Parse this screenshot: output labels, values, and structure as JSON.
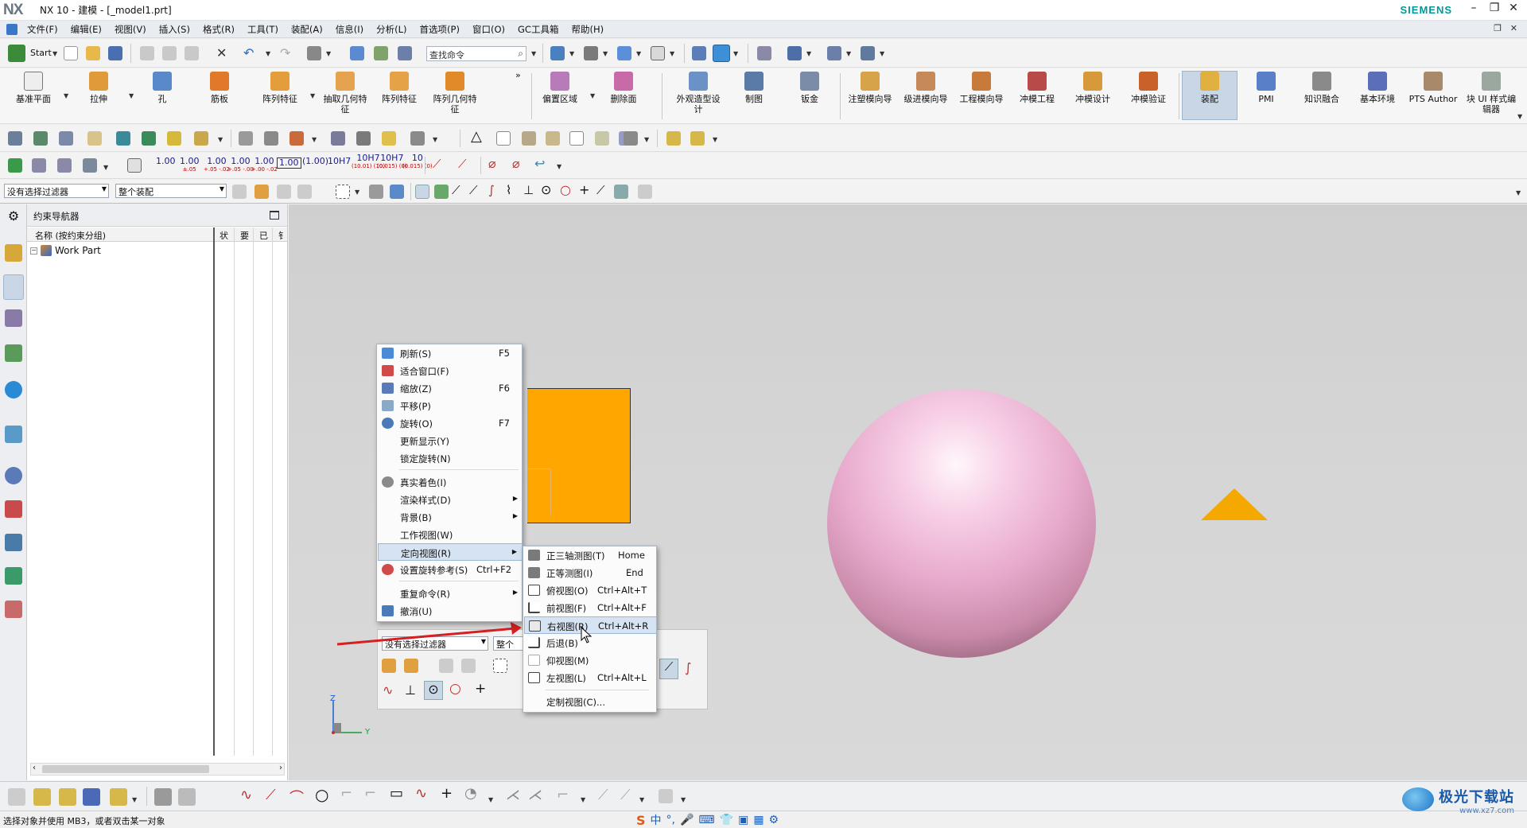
{
  "window": {
    "logo": "NX",
    "title": "NX 10 - 建模 - [_model1.prt]",
    "brand": "SIEMENS",
    "min": "–",
    "restore": "❐",
    "close": "✕"
  },
  "menubar": {
    "items": [
      "文件(F)",
      "编辑(E)",
      "视图(V)",
      "插入(S)",
      "格式(R)",
      "工具(T)",
      "装配(A)",
      "信息(I)",
      "分析(L)",
      "首选项(P)",
      "窗口(O)",
      "GC工具箱",
      "帮助(H)"
    ],
    "mdi_restore": "❐",
    "mdi_close": "✕"
  },
  "toolbar1": {
    "start": "Start",
    "search_placeholder": "查找命令"
  },
  "ribbon": {
    "items": [
      "基准平面",
      "拉伸",
      "孔",
      "筋板",
      "阵列特征",
      "抽取几何特征",
      "阵列特征",
      "阵列几何特征",
      "偏置区域",
      "删除面",
      "外观造型设计",
      "制图",
      "钣金",
      "注塑模向导",
      "级进模向导",
      "工程模向导",
      "冲模工程",
      "冲模设计",
      "冲模验证",
      "装配",
      "PMI",
      "知识融合",
      "基本环境",
      "PTS Author",
      "块 UI 样式编辑器"
    ],
    "active": "装配"
  },
  "toolbar4": {
    "tols": [
      {
        "main": "1.00",
        "sub": ""
      },
      {
        "main": "1.00",
        "sub": "±.05"
      },
      {
        "main": "1.00",
        "sub": "+.05 -.02"
      },
      {
        "main": "1.00",
        "sub": "+.05 -.00"
      },
      {
        "main": "1.00",
        "sub": "+.00 -.02"
      },
      {
        "main": "1.00",
        "sub": ""
      },
      {
        "main": "(1.00)",
        "sub": ""
      },
      {
        "main": "10H7",
        "sub": ""
      },
      {
        "main": "10H7",
        "sub": "(10.01) (10)"
      },
      {
        "main": "10H7",
        "sub": "(0.015) (0)"
      },
      {
        "main": "10",
        "sub": "(0.015) (0)"
      }
    ]
  },
  "selection": {
    "filter": "没有选择过滤器",
    "scope": "整个装配"
  },
  "navigator": {
    "title": "约束导航器",
    "columns": [
      "名称 (按约束分组)",
      "状",
      "要",
      "已",
      "钅"
    ],
    "root": "Work Part"
  },
  "embedded_selbar": {
    "filter": "没有选择过滤器",
    "scope": "整个装"
  },
  "context_menu": {
    "items": [
      {
        "label": "刷新(S)",
        "accel": "F5",
        "icon": "refresh-icon"
      },
      {
        "label": "适合窗口(F)",
        "accel": "",
        "icon": "fit-icon"
      },
      {
        "label": "缩放(Z)",
        "accel": "F6",
        "icon": "zoom-icon"
      },
      {
        "label": "平移(P)",
        "accel": "",
        "icon": "pan-icon"
      },
      {
        "label": "旋转(O)",
        "accel": "F7",
        "icon": "rotate-icon"
      },
      {
        "label": "更新显示(Y)",
        "accel": "",
        "icon": ""
      },
      {
        "label": "锁定旋转(N)",
        "accel": "",
        "icon": ""
      },
      {
        "label": "真实着色(I)",
        "accel": "",
        "icon": "true-shading-icon"
      },
      {
        "label": "渲染样式(D)",
        "accel": "",
        "icon": "",
        "submenu": true
      },
      {
        "label": "背景(B)",
        "accel": "",
        "icon": "",
        "submenu": true
      },
      {
        "label": "工作视图(W)",
        "accel": "",
        "icon": ""
      },
      {
        "label": "定向视图(R)",
        "accel": "",
        "icon": "",
        "submenu": true,
        "highlighted": true
      },
      {
        "label": "设置旋转参考(S)",
        "accel": "Ctrl+F2",
        "icon": "rotate-ref-icon"
      },
      {
        "label": "重复命令(R)",
        "accel": "",
        "icon": "",
        "submenu": true
      },
      {
        "label": "撤消(U)",
        "accel": "",
        "icon": "undo-icon"
      }
    ]
  },
  "submenu": {
    "items": [
      {
        "label": "正三轴测图(T)",
        "accel": "Home"
      },
      {
        "label": "正等测图(I)",
        "accel": "End"
      },
      {
        "label": "俯视图(O)",
        "accel": "Ctrl+Alt+T"
      },
      {
        "label": "前视图(F)",
        "accel": "Ctrl+Alt+F"
      },
      {
        "label": "右视图(R)",
        "accel": "Ctrl+Alt+R",
        "highlighted": true
      },
      {
        "label": "后退(B)",
        "accel": ""
      },
      {
        "label": "仰视图(M)",
        "accel": ""
      },
      {
        "label": "左视图(L)",
        "accel": "Ctrl+Alt+L"
      },
      {
        "label": "定制视图(C)...",
        "accel": ""
      }
    ]
  },
  "axes": {
    "z": "Z",
    "y": "Y"
  },
  "status": {
    "message": "选择对象并使用 MB3，或者双击某一对象",
    "ime_logo": "S",
    "ime_lang": "中"
  },
  "watermark": {
    "line1": "极光下载站",
    "line2": "www.xz7.com"
  },
  "colors": {
    "accent": "#009999",
    "sphere": "#e7a9cb",
    "block": "#ffa600",
    "cone": "#f5a800",
    "highlight": "#d6e3f2",
    "arrow": "#d42020"
  }
}
